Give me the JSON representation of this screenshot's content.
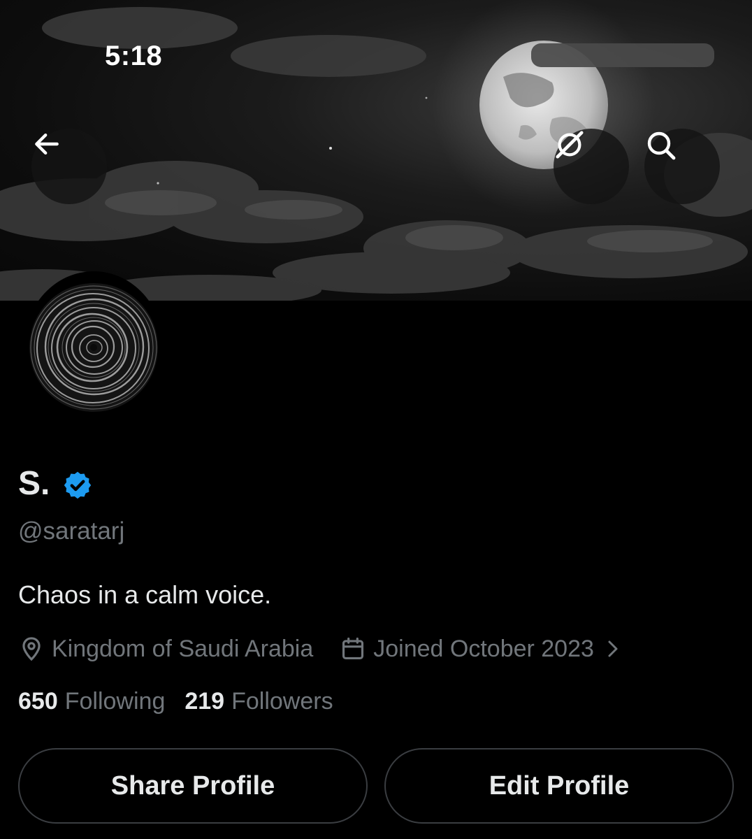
{
  "status_bar": {
    "time": "5:18"
  },
  "header": {
    "back_icon": "arrow-left-icon",
    "grok_icon": "grok-icon",
    "search_icon": "search-icon"
  },
  "profile": {
    "display_name": "S.",
    "verified_icon": "verified-badge-icon",
    "verified_color": "#1d9bf0",
    "handle": "@saratarj",
    "bio": "Chaos in a calm voice.",
    "location": "Kingdom of Saudi Arabia",
    "location_icon": "location-pin-icon",
    "joined": "Joined October 2023",
    "joined_icon": "calendar-icon",
    "joined_chevron": "chevron-right-icon",
    "following_count": "650",
    "following_label": "Following",
    "followers_count": "219",
    "followers_label": "Followers"
  },
  "actions": {
    "share_label": "Share Profile",
    "edit_label": "Edit Profile"
  }
}
